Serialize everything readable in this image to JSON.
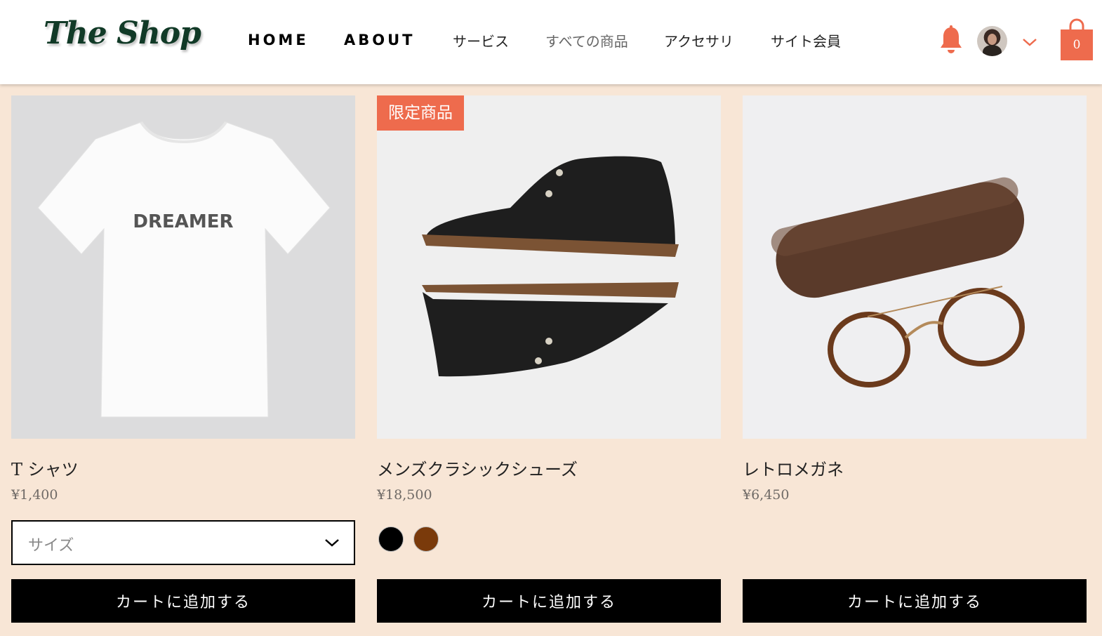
{
  "header": {
    "logo": "The Shop",
    "nav": [
      {
        "label": "HOME"
      },
      {
        "label": "ABOUT"
      },
      {
        "label": "サービス"
      },
      {
        "label": "すべての商品"
      },
      {
        "label": "アクセサリ"
      },
      {
        "label": "サイト会員"
      }
    ],
    "active_nav": "すべての商品",
    "cart_count": "0",
    "icons": [
      "bell-icon",
      "avatar",
      "chevron-down-icon",
      "shopping-bag-icon"
    ]
  },
  "colors": {
    "accent": "#ee6b4d",
    "background": "#f8e6d6",
    "logo": "#113a27",
    "button": "#000000"
  },
  "products": [
    {
      "name": "T シャツ",
      "price": "¥1,400",
      "image_text": "DREAMER",
      "size_placeholder": "サイズ",
      "button": "カートに追加する"
    },
    {
      "badge": "限定商品",
      "name": "メンズクラシックシューズ",
      "price": "¥18,500",
      "swatches": [
        "#000000",
        "#7a3a0b"
      ],
      "button": "カートに追加する"
    },
    {
      "name": "レトロメガネ",
      "price": "¥6,450",
      "button": "カートに追加する"
    }
  ]
}
